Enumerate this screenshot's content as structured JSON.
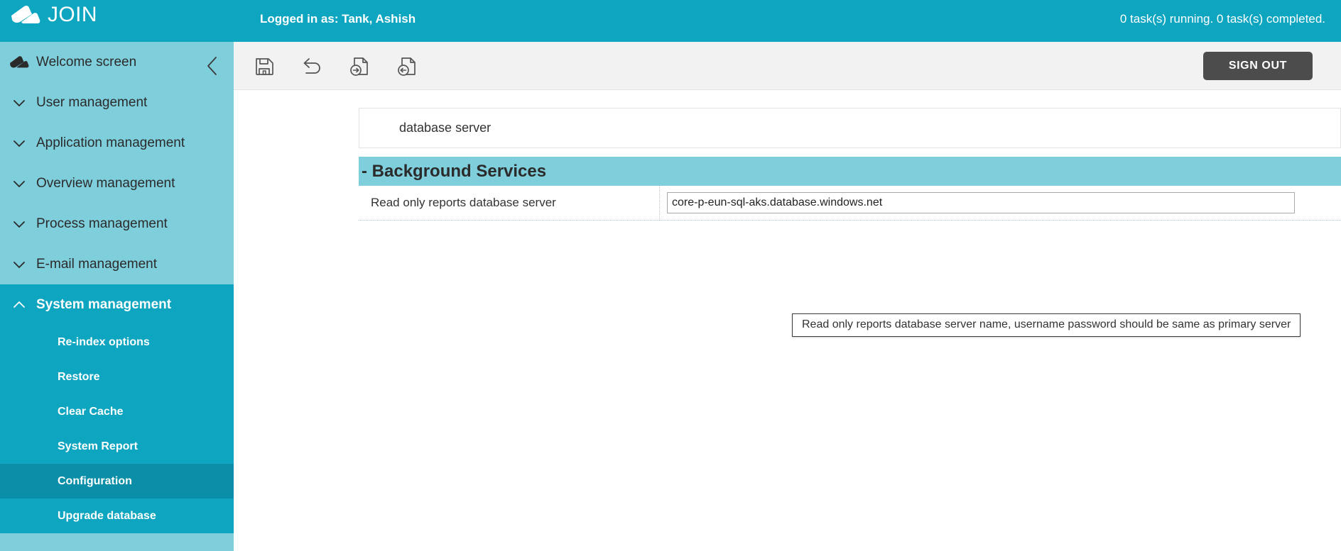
{
  "header": {
    "brand": "JOIN",
    "brand_logo_icon": "join-cloud-logo-icon",
    "logged_in_text": "Logged in as: Tank, Ashish",
    "task_status_text": "0 task(s) running. 0 task(s) completed.",
    "accent_color": "#0EA5C0"
  },
  "sidebar": {
    "background_color": "#7FCEDC",
    "active_color": "#0EA5C0",
    "selected_color": "#0B8FA8",
    "collapse_icon": "chevron-left-icon",
    "items": [
      {
        "label": "Welcome screen",
        "icon": "home-cloud-icon",
        "expanded": false
      },
      {
        "label": "User management",
        "icon": "chevron-down-icon",
        "expanded": false
      },
      {
        "label": "Application management",
        "icon": "chevron-down-icon",
        "expanded": false
      },
      {
        "label": "Overview management",
        "icon": "chevron-down-icon",
        "expanded": false
      },
      {
        "label": "Process management",
        "icon": "chevron-down-icon",
        "expanded": false
      },
      {
        "label": "E-mail management",
        "icon": "chevron-down-icon",
        "expanded": false
      },
      {
        "label": "System management",
        "icon": "chevron-up-icon",
        "expanded": true
      }
    ],
    "sub_items": [
      {
        "label": "Re-index options",
        "active": false
      },
      {
        "label": "Restore",
        "active": false
      },
      {
        "label": "Clear Cache",
        "active": false
      },
      {
        "label": "System Report",
        "active": false
      },
      {
        "label": "Configuration",
        "active": true
      },
      {
        "label": "Upgrade database",
        "active": false
      }
    ]
  },
  "toolbar": {
    "buttons": [
      {
        "name": "save-button",
        "icon": "floppy-disk-icon"
      },
      {
        "name": "undo-button",
        "icon": "undo-arrow-icon"
      },
      {
        "name": "export-button",
        "icon": "document-arrow-right-icon"
      },
      {
        "name": "import-button",
        "icon": "document-arrow-left-icon"
      }
    ],
    "signout_label": "SIGN OUT",
    "signout_color": "#4c4c4c"
  },
  "main": {
    "panel_head_label": "database server",
    "section_title": "- Background Services",
    "section_color": "#7FCEDC",
    "row": {
      "label": "Read only reports database server",
      "value": "core-p-eun-sql-aks.database.windows.net",
      "placeholder": ""
    },
    "tooltip": "Read only reports database server name, username password should be same as primary server"
  }
}
